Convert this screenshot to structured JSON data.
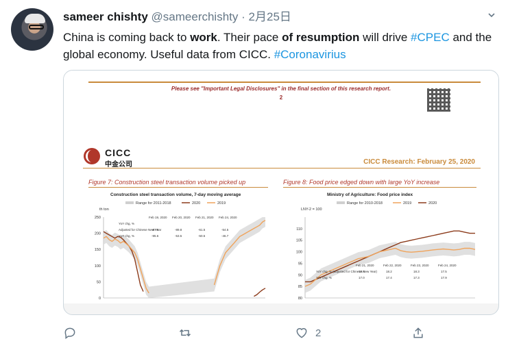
{
  "author": {
    "name": "sameer chishty",
    "handle": "@sameerchishty",
    "separator": "·",
    "date": "2月25日"
  },
  "tweet": {
    "seg1": "China is coming back to ",
    "seg2": "work",
    "seg3": ". Their pace ",
    "seg4": "of resumption",
    "seg5": " will drive ",
    "tag1": "#CPEC",
    "seg6": " and the global economy. Useful data from CICC. ",
    "tag2": "#Coronavirius"
  },
  "doc": {
    "legal": "Please see \"Important Legal Disclosures\" in the final section of this research report.",
    "page": "2",
    "brand_en": "CICC",
    "brand_cn": "中金公司",
    "research": "CICC Research: February 25, 2020",
    "fig7_title": "Figure 7: Construction steel transaction volume picked up",
    "fig7_sub": "Construction steel transaction volume, 7-day moving average",
    "fig8_title": "Figure 8: Food price edged down with large YoY increase",
    "fig8_sub": "Ministry of Agriculture: Food price index"
  },
  "chart_data": [
    {
      "type": "line",
      "title": "Construction steel transaction volume, 7-day moving average",
      "ylabel": "th ton",
      "ylim": [
        0,
        250
      ],
      "yticks": [
        "250",
        "200",
        "150",
        "100",
        "50",
        "0"
      ],
      "legend": [
        "Range for 2011-2018",
        "2020",
        "2019"
      ],
      "table_headers": [
        "Feb 19, 2020",
        "Feb 20, 2020",
        "Feb 21, 2020",
        "Feb 24, 2020"
      ],
      "table_rows": [
        {
          "label": "YoY chg, %",
          "values": [
            "",
            "",
            "",
            ""
          ]
        },
        {
          "label": "Adjusted for Chinese New Year",
          "values": [
            "-87.6",
            "-89.8",
            "-61.5",
            "-54.5"
          ]
        },
        {
          "label": "YoY chg, %",
          "values": [
            "-95.6",
            "-53.5",
            "-50.5",
            "-46.7"
          ]
        }
      ],
      "series": [
        {
          "name": "2020",
          "color": "#8b3a1a",
          "values": [
            205,
            200,
            195,
            190,
            185,
            190,
            188,
            180,
            170,
            160,
            145,
            120,
            80,
            40,
            20,
            null,
            null,
            null,
            null,
            null,
            null,
            null,
            null,
            null,
            null,
            null,
            null,
            null,
            null,
            null,
            null,
            null,
            null,
            null,
            null,
            null,
            null,
            null,
            null,
            null,
            null,
            null,
            null,
            null,
            null,
            null,
            null,
            null,
            null,
            null,
            null,
            null,
            null,
            5,
            10,
            18,
            25,
            30
          ]
        },
        {
          "name": "2019",
          "color": "#f0a35a",
          "values": [
            185,
            190,
            180,
            175,
            182,
            178,
            170,
            175,
            168,
            160,
            150,
            140,
            120,
            90,
            60,
            30,
            15,
            null,
            null,
            null,
            null,
            null,
            null,
            null,
            null,
            null,
            null,
            null,
            null,
            null,
            null,
            null,
            null,
            null,
            null,
            null,
            null,
            null,
            null,
            40,
            70,
            100,
            120,
            140,
            150,
            160,
            170,
            180,
            190,
            195,
            200,
            205,
            210,
            215,
            220,
            225,
            235,
            240
          ]
        },
        {
          "name": "Range for 2011-2018",
          "color": "#cfcfcf",
          "values": []
        }
      ]
    },
    {
      "type": "line",
      "title": "Ministry of Agriculture: Food price index",
      "ylabel": "LNY-2 = 100",
      "ylim": [
        80,
        115
      ],
      "yticks": [
        "110",
        "105",
        "100",
        "95",
        "90",
        "85",
        "80"
      ],
      "legend": [
        "Range for 2010-2018",
        "2019",
        "2020"
      ],
      "table_headers": [
        "Feb 21, 2020",
        "Feb 22, 2020",
        "Feb 23, 2020",
        "Feb 24, 2020"
      ],
      "table_rows": [
        {
          "label": "YoY chg, % (adjusted for Chinese New Year)",
          "values": [
            "18.8",
            "18.2",
            "18.3",
            "17.5"
          ]
        },
        {
          "label": "YoY chg, %",
          "values": [
            "17.0",
            "17.4",
            "17.3",
            "17.9"
          ]
        }
      ],
      "series": [
        {
          "name": "2020",
          "color": "#8b3a1a",
          "values": [
            87,
            87,
            88,
            89,
            90,
            91,
            92,
            93,
            94,
            95,
            96,
            97,
            98,
            99,
            100,
            101,
            102,
            103,
            104,
            104.5,
            105,
            105.5,
            106,
            106.5,
            107,
            107.5,
            108,
            108.5,
            109,
            109,
            108.5,
            108,
            108
          ]
        },
        {
          "name": "2019",
          "color": "#f0a35a",
          "values": [
            85,
            86,
            88,
            90,
            91,
            92,
            93,
            94,
            95,
            96,
            97,
            97.5,
            98,
            99,
            100,
            100.5,
            101,
            101.5,
            100.5,
            100,
            99.8,
            100,
            100.2,
            100.5,
            100.8,
            101,
            101.2,
            101,
            100.8,
            101,
            101.5,
            101.5,
            101
          ]
        },
        {
          "name": "Range for 2010-2018",
          "color": "#cfcfcf",
          "values": []
        }
      ]
    }
  ],
  "actions": {
    "reply": "",
    "retweet": "",
    "like_count": "2",
    "share": ""
  }
}
